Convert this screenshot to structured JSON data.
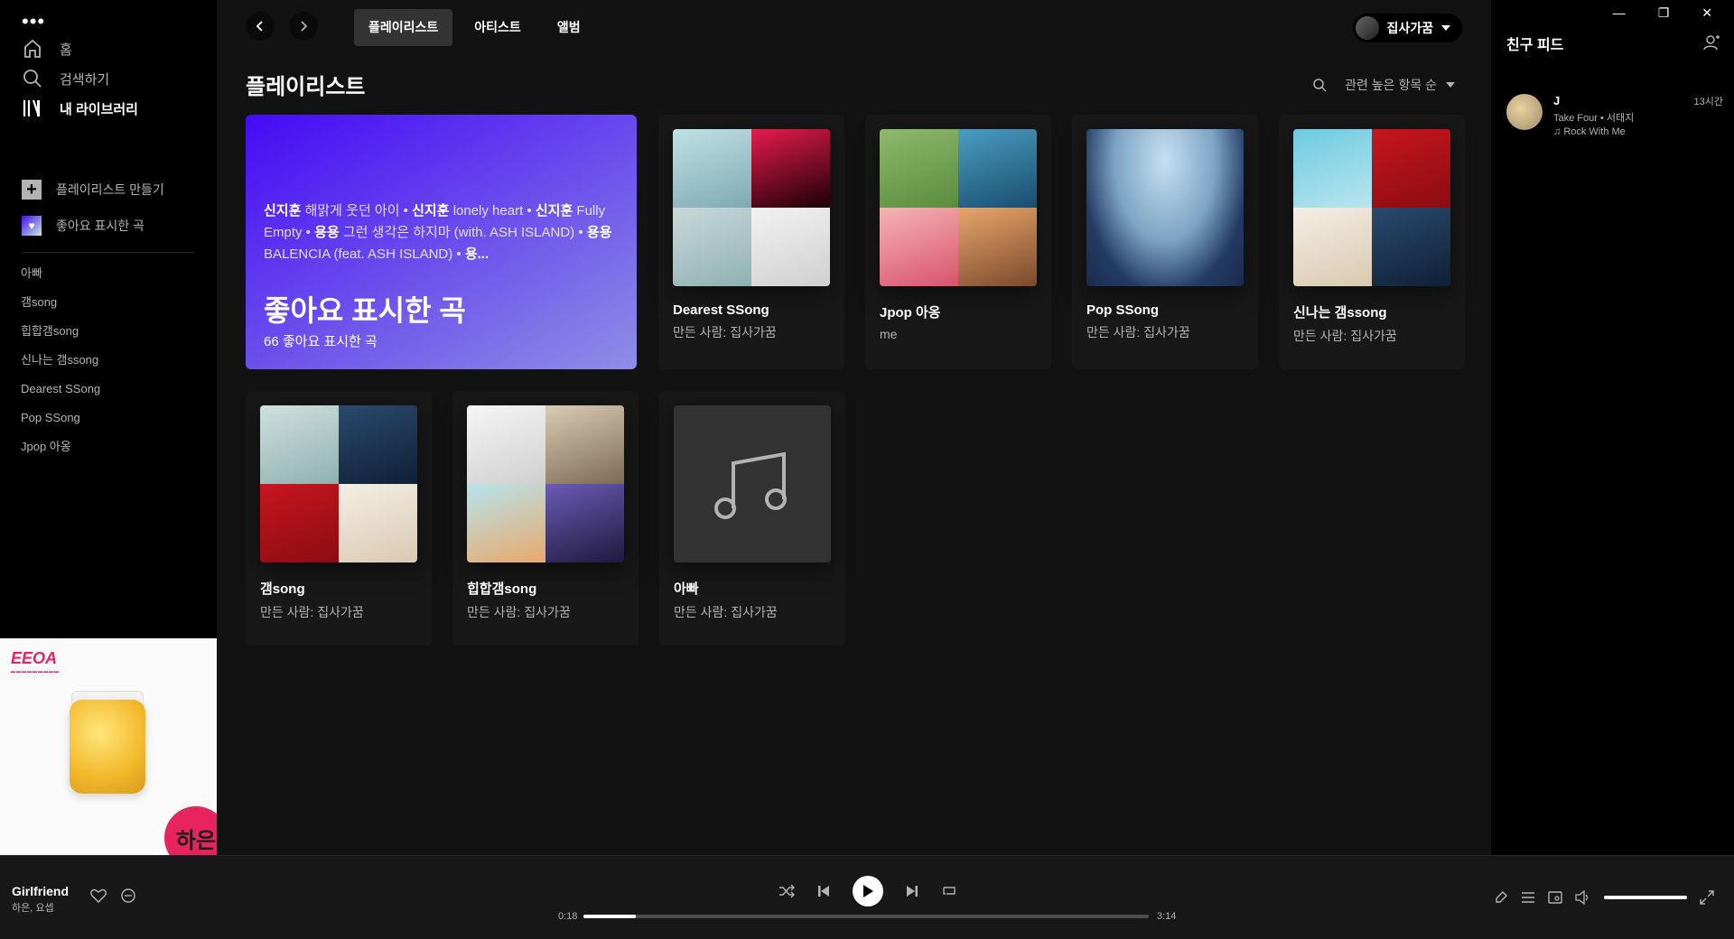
{
  "sidebar": {
    "nav": [
      {
        "label": "홈",
        "icon": "home-icon"
      },
      {
        "label": "검색하기",
        "icon": "search-icon"
      },
      {
        "label": "내 라이브러리",
        "icon": "library-icon"
      }
    ],
    "create_playlist": "플레이리스트 만들기",
    "liked_songs": "좋아요 표시한 곡",
    "playlists": [
      "아빠",
      "갬song",
      "힙합갬song",
      "신나는 갬ssong",
      "Dearest SSong",
      "Pop SSong",
      "Jpop 아옹"
    ]
  },
  "now_art": {
    "logo": "EEOA",
    "badge": "하은"
  },
  "topbar": {
    "tabs": [
      "플레이리스트",
      "아티스트",
      "앨범"
    ],
    "active_tab": "플레이리스트",
    "user_name": "집사가꿈"
  },
  "main": {
    "title": "플레이리스트",
    "sort_label": "관련 높은 항목 순"
  },
  "liked_card": {
    "snippet": [
      {
        "artist": "신지훈",
        "song": "해맑게 웃던 아이"
      },
      {
        "artist": "신지훈",
        "song": "lonely heart"
      },
      {
        "artist": "신지훈",
        "song": "Fully Empty"
      },
      {
        "artist": "용용",
        "song": "그런 생각은 하지마 (with. ASH ISLAND)"
      },
      {
        "artist": "용용",
        "song": "BALENCIA (feat. ASH ISLAND)"
      },
      {
        "artist": "용...",
        "song": ""
      }
    ],
    "title": "좋아요 표시한 곡",
    "count": "66 좋아요 표시한 곡"
  },
  "cards": [
    {
      "title": "Dearest SSong",
      "sub": "만든 사람: 집사가꿈"
    },
    {
      "title": "Jpop 아옹",
      "sub": "me"
    },
    {
      "title": "Pop SSong",
      "sub": "만든 사람: 집사가꿈"
    },
    {
      "title": "신나는 갬ssong",
      "sub": "만든 사람: 집사가꿈"
    },
    {
      "title": "갬song",
      "sub": "만든 사람: 집사가꿈"
    },
    {
      "title": "힙합갬song",
      "sub": "만든 사람: 집사가꿈"
    },
    {
      "title": "아빠",
      "sub": "만든 사람: 집사가꿈"
    }
  ],
  "friends": {
    "title": "친구 피드",
    "items": [
      {
        "name": "J",
        "time": "13시간",
        "track": "Take Four • 서태지",
        "source": "Rock With Me"
      }
    ]
  },
  "player": {
    "title": "Girlfriend",
    "artist": "하은, 요셉",
    "elapsed": "0:18",
    "duration": "3:14",
    "progress": 0.093,
    "volume": 1.0
  },
  "colors": {
    "accent": "#ffffff",
    "liked_gradient_start": "#450af5",
    "liked_gradient_end": "#8e8ee5"
  }
}
